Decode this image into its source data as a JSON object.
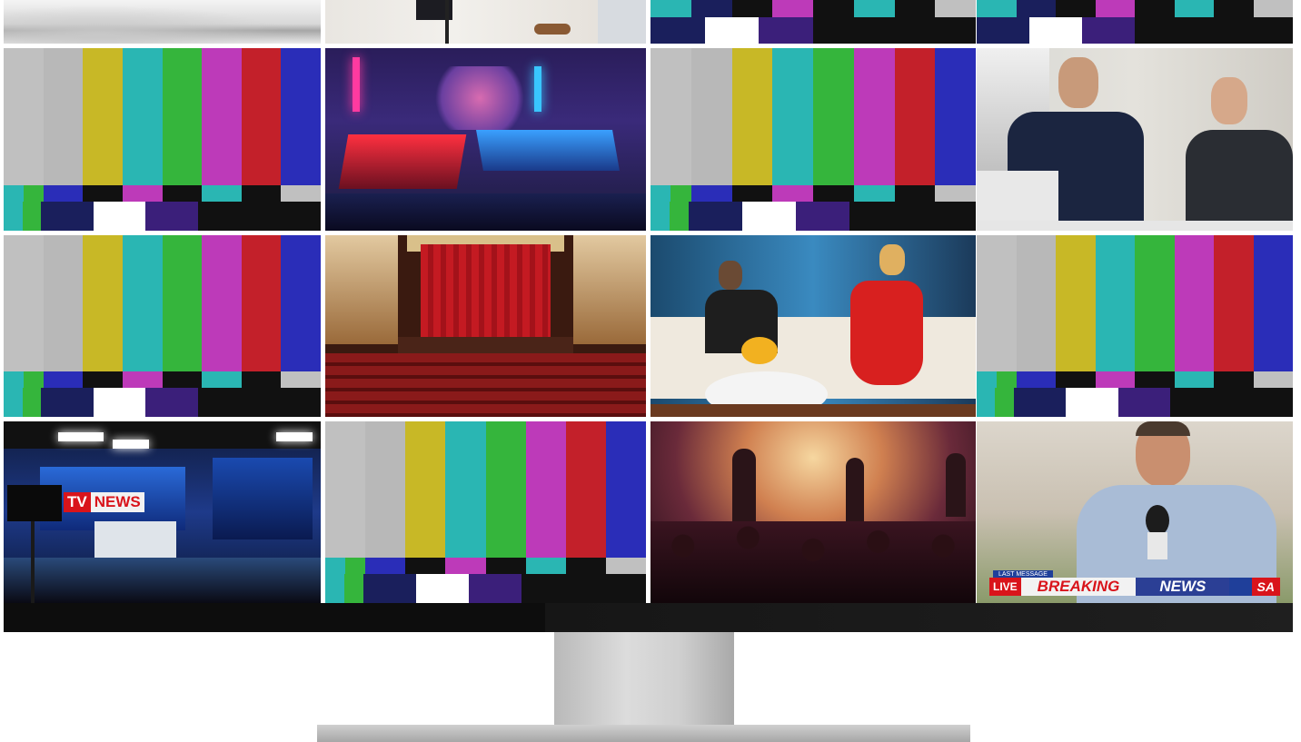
{
  "grid": {
    "tiles": [
      {
        "kind": "photo",
        "scene": "silver-car-detail"
      },
      {
        "kind": "photo",
        "scene": "office-legs-tripod"
      },
      {
        "kind": "bars-partial"
      },
      {
        "kind": "bars-partial"
      },
      {
        "kind": "bars"
      },
      {
        "kind": "photo",
        "scene": "esports-arena"
      },
      {
        "kind": "bars"
      },
      {
        "kind": "photo",
        "scene": "news-anchors-studio"
      },
      {
        "kind": "bars"
      },
      {
        "kind": "photo",
        "scene": "theater-red-curtain"
      },
      {
        "kind": "photo",
        "scene": "talk-show-interview"
      },
      {
        "kind": "bars"
      },
      {
        "kind": "photo",
        "scene": "tv-news-studio"
      },
      {
        "kind": "bars"
      },
      {
        "kind": "photo",
        "scene": "concert-crowd"
      },
      {
        "kind": "photo",
        "scene": "reporter-with-microphone"
      }
    ],
    "bar_colors_top": [
      "#c0c0c0",
      "#c0c0c0",
      "#c8b826",
      "#2ab6b3",
      "#35b53c",
      "#bd3ab9",
      "#c3202a",
      "#2a2db8"
    ],
    "bar_colors_mid": [
      "#2a2db8",
      "#111111",
      "#bd3ab9",
      "#111111",
      "#2ab6b3",
      "#111111",
      "#c0c0c0"
    ],
    "bar_colors_bot": [
      "#1a1f5c",
      "#ffffff",
      "#3b1f7a",
      "#111111",
      "#111111",
      "#111111",
      "#111111"
    ]
  },
  "tv_news": {
    "tv": "TV",
    "news": "NEWS"
  },
  "breaking": {
    "last_message": "LAST MESSAGE",
    "live": "LIVE",
    "breaking": "BREAKING",
    "news": "NEWS",
    "sa": "SA"
  },
  "monitor": {
    "color": "#0d0d0d"
  }
}
